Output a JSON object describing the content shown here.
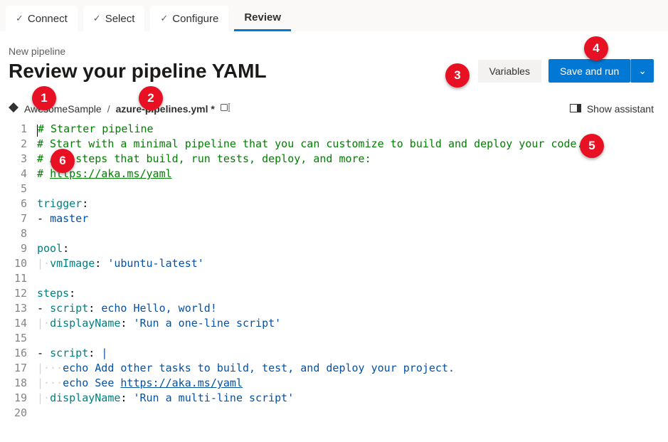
{
  "wizard": {
    "tabs": [
      {
        "label": "Connect",
        "done": true
      },
      {
        "label": "Select",
        "done": true
      },
      {
        "label": "Configure",
        "done": true
      },
      {
        "label": "Review",
        "active": true
      }
    ]
  },
  "header": {
    "subtitle": "New pipeline",
    "title": "Review your pipeline YAML",
    "variables_label": "Variables",
    "save_run_label": "Save and run"
  },
  "breadcrumb": {
    "repo": "AwesomeSample",
    "sep": "/",
    "file": "azure-pipelines.yml *"
  },
  "assistant": {
    "label": "Show assistant"
  },
  "code": {
    "lines": [
      {
        "n": 1,
        "type": "comment",
        "text": "# Starter pipeline"
      },
      {
        "n": 2,
        "type": "comment",
        "text": "# Start with a minimal pipeline that you can customize to build and deploy your code."
      },
      {
        "n": 3,
        "type": "comment",
        "text": "# Add steps that build, run tests, deploy, and more:"
      },
      {
        "n": 4,
        "type": "comment-link",
        "prefix": "# ",
        "link": "https://aka.ms/yaml"
      },
      {
        "n": 5,
        "type": "blank"
      },
      {
        "n": 6,
        "type": "key",
        "key": "trigger",
        "after": ":"
      },
      {
        "n": 7,
        "type": "list-plain",
        "dash": "- ",
        "value": "master"
      },
      {
        "n": 8,
        "type": "blank"
      },
      {
        "n": 9,
        "type": "key",
        "key": "pool",
        "after": ":"
      },
      {
        "n": 10,
        "type": "indent-kv",
        "indent": "··",
        "key": "vmImage",
        "value": "'ubuntu-latest'"
      },
      {
        "n": 11,
        "type": "blank"
      },
      {
        "n": 12,
        "type": "key",
        "key": "steps",
        "after": ":"
      },
      {
        "n": 13,
        "type": "list-kv",
        "dash": "- ",
        "key": "script",
        "value": "echo Hello, world!"
      },
      {
        "n": 14,
        "type": "indent-kv",
        "indent": "··",
        "key": "displayName",
        "value": "'Run a one-line script'"
      },
      {
        "n": 15,
        "type": "blank"
      },
      {
        "n": 16,
        "type": "list-kv-pipe",
        "dash": "- ",
        "key": "script",
        "value": "|"
      },
      {
        "n": 17,
        "type": "indent-plain",
        "indent": "····",
        "value": "echo Add other tasks to build, test, and deploy your project."
      },
      {
        "n": 18,
        "type": "indent-plain-link",
        "indent": "····",
        "prefix": "echo See ",
        "link": "https://aka.ms/yaml"
      },
      {
        "n": 19,
        "type": "indent-kv",
        "indent": "··",
        "key": "displayName",
        "value": "'Run a multi-line script'"
      },
      {
        "n": 20,
        "type": "blank"
      }
    ]
  },
  "callouts": {
    "1": "1",
    "2": "2",
    "3": "3",
    "4": "4",
    "5": "5",
    "6": "6"
  }
}
